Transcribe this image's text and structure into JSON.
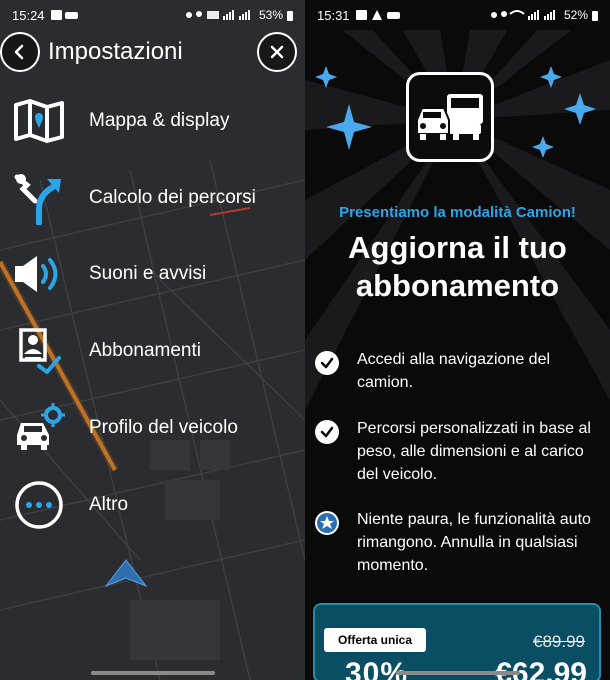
{
  "left": {
    "status": {
      "time": "15:24",
      "battery": "53%"
    },
    "title": "Impostazioni",
    "menu": [
      {
        "label": "Mappa & display",
        "icon": "map-icon"
      },
      {
        "label": "Calcolo dei percorsi",
        "icon": "route-icon"
      },
      {
        "label": "Suoni e avvisi",
        "icon": "speaker-icon"
      },
      {
        "label": "Abbonamenti",
        "icon": "subscription-icon"
      },
      {
        "label": "Profilo del veicolo",
        "icon": "vehicle-profile-icon"
      },
      {
        "label": "Altro",
        "icon": "more-icon"
      }
    ]
  },
  "right": {
    "status": {
      "time": "15:31",
      "battery": "52%"
    },
    "promo_label": "Presentiamo la modalità Camion!",
    "headline_line1": "Aggiorna il tuo",
    "headline_line2": "abbonamento",
    "features": [
      {
        "text": "Accedi alla navigazione del camion.",
        "icon": "check-icon"
      },
      {
        "text": "Percorsi personalizzati in base al peso, alle dimensioni e al carico del veicolo.",
        "icon": "check-icon"
      },
      {
        "text": "Niente paura, le funzionalità auto rimangono. Annulla in qualsiasi momento.",
        "icon": "star-icon"
      }
    ],
    "offer": {
      "badge": "Offerta unica",
      "old_price": "€89.99",
      "cut_left": "30%",
      "cut_right": "€62.99"
    }
  },
  "colors": {
    "accent": "#2aa6e8",
    "offer_bg": "#0a4e63",
    "route_orange": "#d9822b"
  }
}
